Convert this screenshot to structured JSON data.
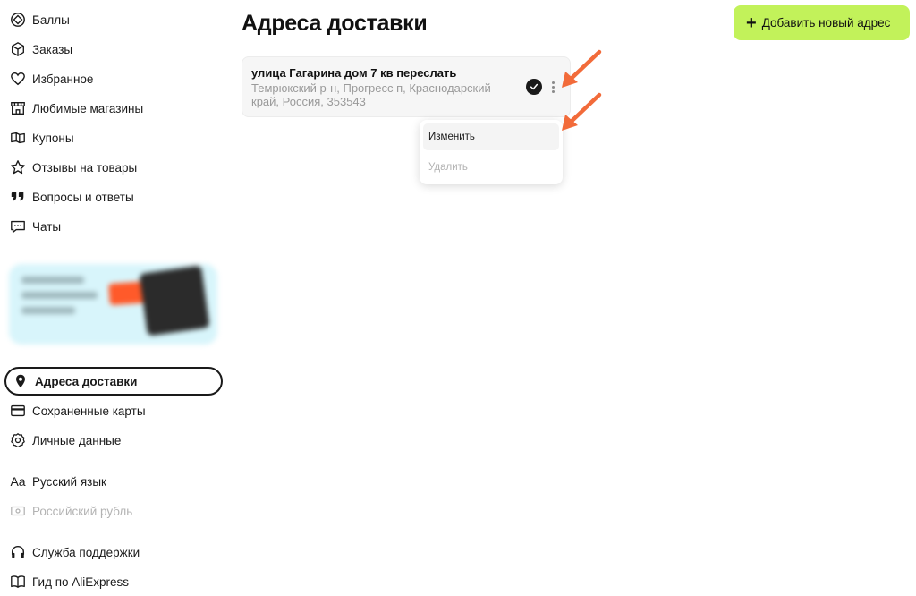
{
  "sidebar": {
    "items": [
      {
        "label": "Баллы",
        "icon": "points-icon"
      },
      {
        "label": "Заказы",
        "icon": "box-icon"
      },
      {
        "label": "Избранное",
        "icon": "heart-icon"
      },
      {
        "label": "Любимые магазины",
        "icon": "store-icon"
      },
      {
        "label": "Купоны",
        "icon": "coupon-icon"
      },
      {
        "label": "Отзывы на товары",
        "icon": "star-icon"
      },
      {
        "label": "Вопросы и ответы",
        "icon": "quote-icon"
      },
      {
        "label": "Чаты",
        "icon": "chat-icon"
      }
    ],
    "items2": [
      {
        "label": "Адреса доставки",
        "icon": "location-pin-icon",
        "active": true
      },
      {
        "label": "Сохраненные карты",
        "icon": "card-icon"
      },
      {
        "label": "Личные данные",
        "icon": "gear-icon"
      }
    ],
    "items3": [
      {
        "label": "Русский язык",
        "icon": "language-icon",
        "glyph": "Aa"
      },
      {
        "label": "Российский рубль",
        "icon": "currency-icon",
        "disabled": true
      }
    ],
    "items4": [
      {
        "label": "Служба поддержки",
        "icon": "headphones-icon"
      },
      {
        "label": "Гид по AliExpress",
        "icon": "book-icon"
      }
    ]
  },
  "main": {
    "title": "Адреса доставки",
    "add_button": "Добавить новый адрес",
    "address": {
      "title": "улица Гагарина дом 7 кв переслать",
      "details": "Темрюкский р-н, Прогресс п, Краснодарский край, Россия, 353543"
    },
    "menu": {
      "edit": "Изменить",
      "delete": "Удалить"
    }
  },
  "colors": {
    "accent": "#c2f25a",
    "arrow": "#f26b3a",
    "text": "#1a1a1a",
    "muted": "#9a9a9a"
  }
}
